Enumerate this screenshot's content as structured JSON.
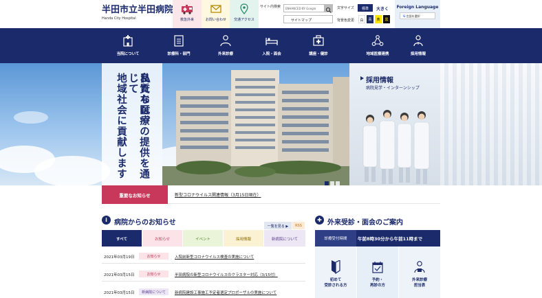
{
  "header": {
    "hospital_name": "半田市立半田病院",
    "hospital_name_en": "Handa City Hospital",
    "quick_links": [
      {
        "label": "救急外来",
        "icon": "ambulance-icon"
      },
      {
        "label": "お問い合わせ",
        "icon": "mail-icon"
      },
      {
        "label": "交通アクセス",
        "icon": "map-pin-icon"
      }
    ],
    "site_search_label": "サイト内検索",
    "search_placeholder": "ENHANCED BY Google",
    "sitemap_label": "サイトマップ",
    "font_size_label": "文字サイズ",
    "font_size_standard": "標準",
    "font_size_large": "大きく",
    "bg_color_label": "背景色変更",
    "bg_colors": [
      "白",
      "青",
      "黄",
      "黒"
    ],
    "foreign_language_label": "Foreign Language",
    "translate_label": "言語を選択"
  },
  "nav": [
    {
      "label": "当院について",
      "icon": "hospital-icon"
    },
    {
      "label": "診療科・部門",
      "icon": "clipboard-icon"
    },
    {
      "label": "外来診療",
      "icon": "doctor-icon"
    },
    {
      "label": "入院・面会",
      "icon": "bed-icon"
    },
    {
      "label": "講座・健診",
      "icon": "medical-kit-icon"
    },
    {
      "label": "地域医療連携",
      "icon": "network-icon"
    },
    {
      "label": "採用情報",
      "icon": "person-icon"
    }
  ],
  "hero": {
    "catch_lines": [
      "私たちは、",
      "良質な医療の提供を通じて",
      "地域社会に貢献します"
    ],
    "building_sign": "半田市立半田病院",
    "recruit_title": "採用情報",
    "recruit_sub": "病院見学・インターンシップ"
  },
  "important_notice": {
    "label": "重要なお知らせ",
    "text": "新型コロナウイルス関連情報（3月15日現在）"
  },
  "news": {
    "title": "病院からのお知らせ",
    "more_label": "一覧を見る ▶",
    "rss_label": "RSS",
    "tabs": [
      "すべて",
      "お知らせ",
      "イベント",
      "採用情報",
      "新病院について"
    ],
    "items": [
      {
        "date": "2021年03月19日",
        "category": "お知らせ",
        "title": "入院前新型コロナウイルス検査の実施について"
      },
      {
        "date": "2021年03月15日",
        "category": "お知らせ",
        "title": "半田病院の新型コロナウイルスのクラスター対応（3/15付）"
      },
      {
        "date": "2021年03月15日",
        "category": "新病院について",
        "title": "新病院建設工事施工予定者選定プロポーザルの実施について"
      }
    ]
  },
  "outpatient": {
    "title": "外来受診・面会のご案内",
    "hours_label": "診療受付時間",
    "hours_value": "午前8時30分から午前11時まで",
    "cards": [
      {
        "label_line1": "初めて",
        "label_line2": "受診される方",
        "icon": "beginner-mark-icon"
      },
      {
        "label_line1": "予約・",
        "label_line2": "再診の方",
        "icon": "calendar-icon"
      },
      {
        "label_line1": "外来診療",
        "label_line2": "担当表",
        "icon": "doctor-schedule-icon"
      }
    ]
  },
  "colors": {
    "brand_navy": "#1b2a6b",
    "notice_red": "#c8385a"
  }
}
